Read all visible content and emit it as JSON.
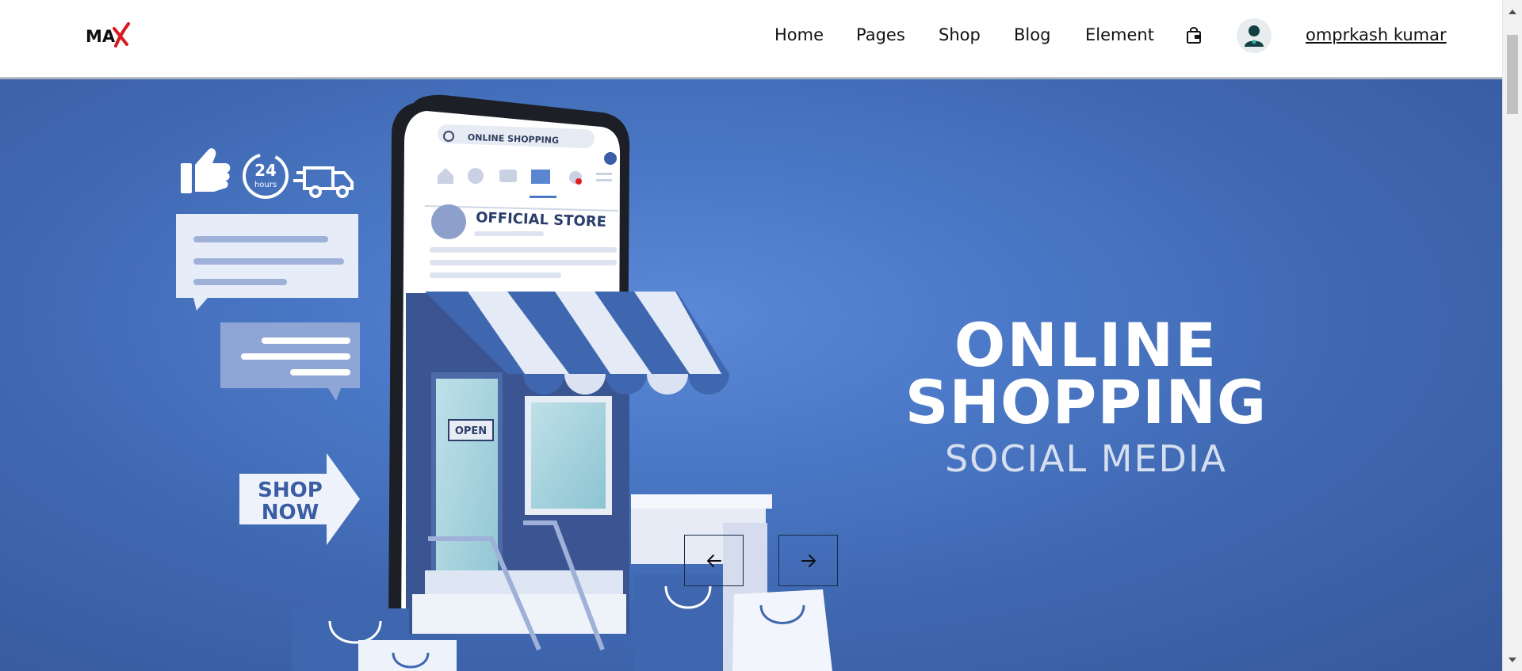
{
  "header": {
    "logo_text": "MAX",
    "nav": [
      {
        "label": "Home"
      },
      {
        "label": "Pages"
      },
      {
        "label": "Shop"
      },
      {
        "label": "Blog"
      },
      {
        "label": "Element"
      }
    ],
    "cart_icon": "shopping-bag-icon",
    "avatar_icon": "user-icon",
    "username": "omprkash kumar"
  },
  "hero": {
    "title_line1": "ONLINE",
    "title_line2": "SHOPPING",
    "subtitle": "SOCIAL MEDIA",
    "art": {
      "search_text": "ONLINE SHOPPING",
      "store_name": "OFFICIAL STORE",
      "hours_number": "24",
      "hours_label": "hours",
      "door_sign": "OPEN",
      "shop_now_line1": "SHOP",
      "shop_now_line2": "NOW"
    },
    "prev_icon": "arrow-left-icon",
    "next_icon": "arrow-right-icon"
  },
  "colors": {
    "hero_bg": "#4a78c6",
    "text_dark": "#111111",
    "white": "#ffffff"
  }
}
